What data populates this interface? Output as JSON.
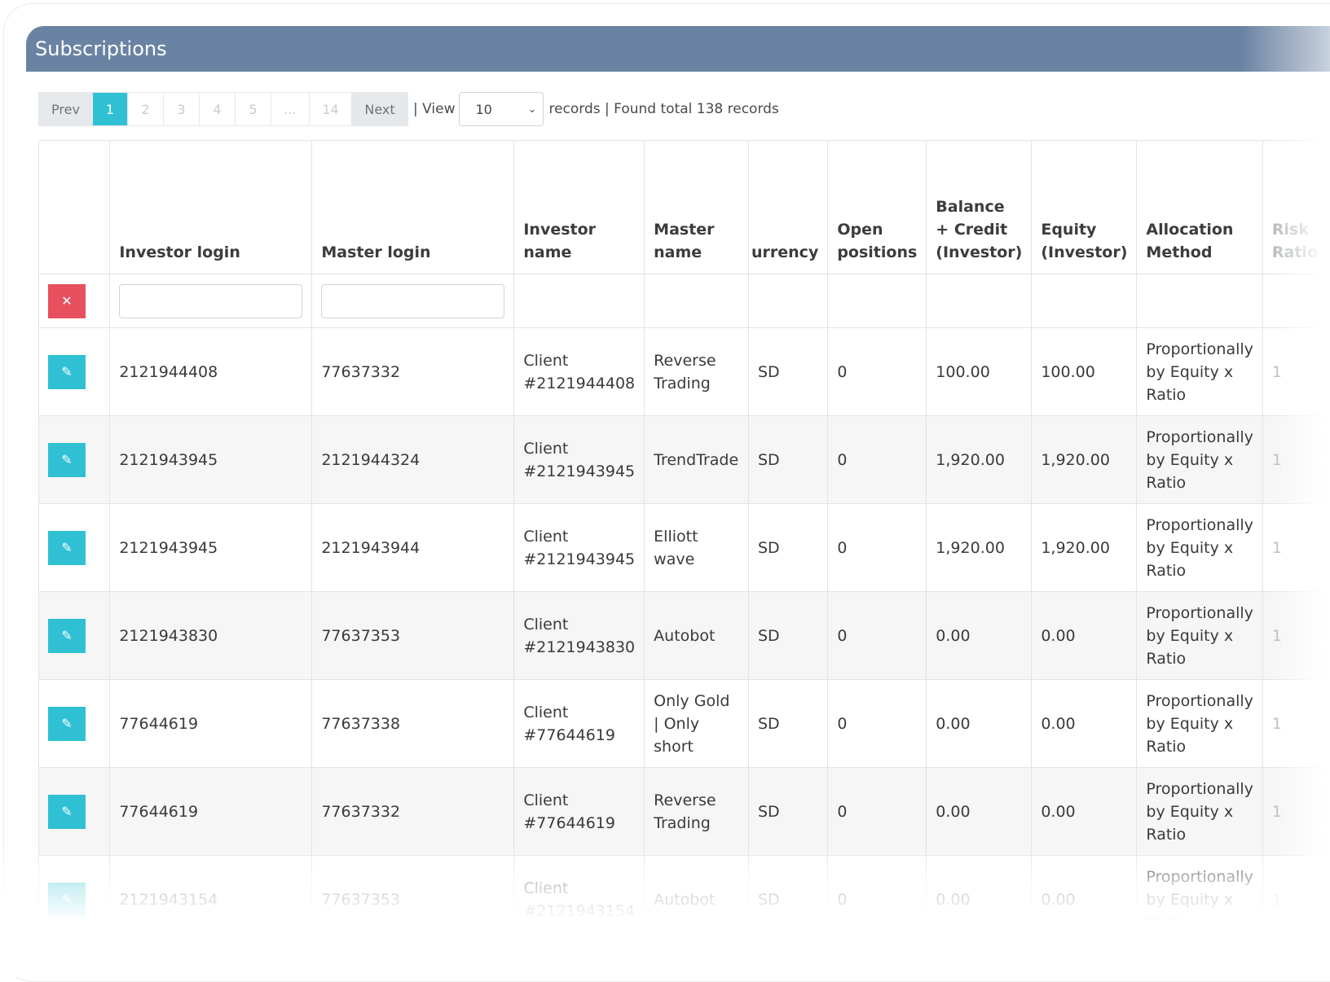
{
  "panel": {
    "title": "Subscriptions"
  },
  "pager": {
    "prev_label": "Prev",
    "pages": [
      "1",
      "2",
      "3",
      "4",
      "5",
      "...",
      "14"
    ],
    "active_page": "1",
    "next_label": "Next",
    "view_prefix": "| View",
    "view_value": "10",
    "records_text": "records | Found total 138 records"
  },
  "table": {
    "headers": {
      "investor_login": "Investor login",
      "master_login": "Master login",
      "investor_name": "Investor name",
      "master_name": "Master name",
      "currency": "urrency",
      "open_positions": "Open positions",
      "balance_credit": "Balance + Credit (Investor)",
      "equity": "Equity (Investor)",
      "allocation_method": "Allocation Method",
      "risk_ratio": "Risk Ratio"
    },
    "clear_icon": "x-icon",
    "edit_icon": "pencil-icon",
    "rows": [
      {
        "investor_login": "2121944408",
        "master_login": "77637332",
        "investor_name": "Client #2121944408",
        "master_name": "Reverse Trading",
        "currency": "SD",
        "open_positions": "0",
        "balance_credit": "100.00",
        "equity": "100.00",
        "allocation_method": "Proportionally by Equity x Ratio",
        "risk_ratio": "1"
      },
      {
        "investor_login": "2121943945",
        "master_login": "2121944324",
        "investor_name": "Client #2121943945",
        "master_name": "TrendTrade",
        "currency": "SD",
        "open_positions": "0",
        "balance_credit": "1,920.00",
        "equity": "1,920.00",
        "allocation_method": "Proportionally by Equity x Ratio",
        "risk_ratio": "1"
      },
      {
        "investor_login": "2121943945",
        "master_login": "2121943944",
        "investor_name": "Client #2121943945",
        "master_name": "Elliott wave",
        "currency": "SD",
        "open_positions": "0",
        "balance_credit": "1,920.00",
        "equity": "1,920.00",
        "allocation_method": "Proportionally by Equity x Ratio",
        "risk_ratio": "1"
      },
      {
        "investor_login": "2121943830",
        "master_login": "77637353",
        "investor_name": "Client #2121943830",
        "master_name": "Autobot",
        "currency": "SD",
        "open_positions": "0",
        "balance_credit": "0.00",
        "equity": "0.00",
        "allocation_method": "Proportionally by Equity x Ratio",
        "risk_ratio": "1"
      },
      {
        "investor_login": "77644619",
        "master_login": "77637338",
        "investor_name": "Client #77644619",
        "master_name": "Only Gold | Only short",
        "currency": "SD",
        "open_positions": "0",
        "balance_credit": "0.00",
        "equity": "0.00",
        "allocation_method": "Proportionally by Equity x Ratio",
        "risk_ratio": "1"
      },
      {
        "investor_login": "77644619",
        "master_login": "77637332",
        "investor_name": "Client #77644619",
        "master_name": "Reverse Trading",
        "currency": "SD",
        "open_positions": "0",
        "balance_credit": "0.00",
        "equity": "0.00",
        "allocation_method": "Proportionally by Equity x Ratio",
        "risk_ratio": "1"
      },
      {
        "investor_login": "2121943154",
        "master_login": "77637353",
        "investor_name": "Client #2121943154",
        "master_name": "Autobot",
        "currency": "SD",
        "open_positions": "0",
        "balance_credit": "0.00",
        "equity": "0.00",
        "allocation_method": "Proportionally by Equity x Ratio",
        "risk_ratio": "1"
      }
    ]
  },
  "colors": {
    "header": "#6a83a3",
    "accent": "#2fc1d3",
    "danger": "#e8505f"
  }
}
